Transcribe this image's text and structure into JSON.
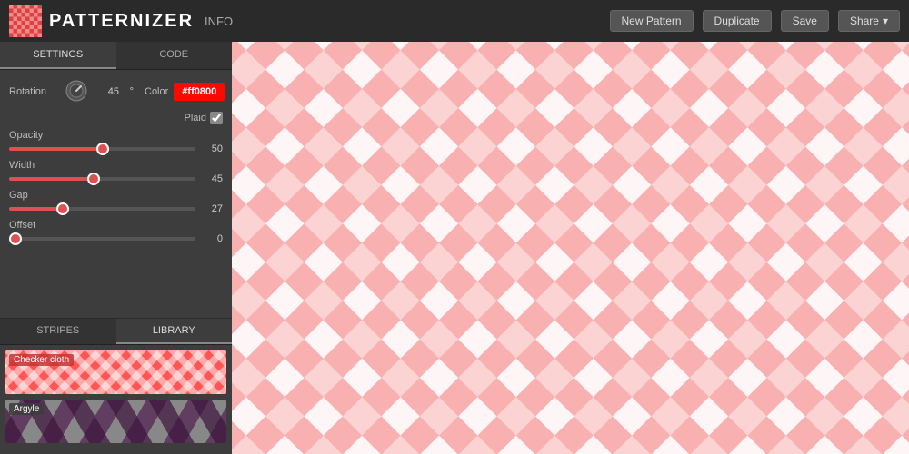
{
  "header": {
    "logo_text": "PATTERNIZER",
    "info_label": "INFO",
    "buttons": {
      "new_pattern": "New Pattern",
      "duplicate": "Duplicate",
      "save": "Save",
      "share": "Share"
    }
  },
  "sidebar": {
    "settings_tab": "SETTINGS",
    "code_tab": "CODE",
    "rotation_label": "Rotation",
    "rotation_value": "45",
    "rotation_unit": "°",
    "color_label": "Color",
    "color_value": "#ff0800",
    "plaid_label": "Plaid",
    "opacity_label": "Opacity",
    "opacity_value": "50",
    "width_label": "Width",
    "width_value": "45",
    "gap_label": "Gap",
    "gap_value": "27",
    "offset_label": "Offset",
    "offset_value": "0"
  },
  "library": {
    "stripes_tab": "STRIPES",
    "library_tab": "LIBRARY",
    "items": [
      {
        "name": "Checker cloth",
        "type": "gingham"
      },
      {
        "name": "Argyle",
        "type": "argyle"
      }
    ]
  },
  "icons": {
    "chevron_down": "▾",
    "checkmark": "✓"
  }
}
